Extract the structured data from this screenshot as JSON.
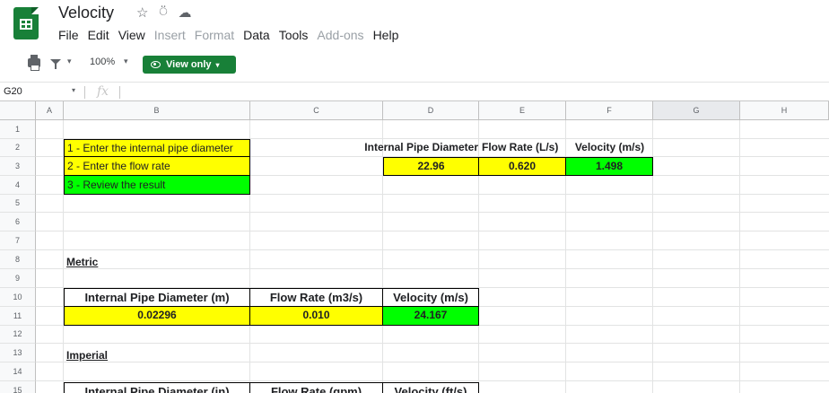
{
  "doc": {
    "title": "Velocity"
  },
  "title_icons": {
    "star": "☆",
    "share": "⍥",
    "cloud": "☁"
  },
  "menu": [
    {
      "label": "File",
      "enabled": true
    },
    {
      "label": "Edit",
      "enabled": true
    },
    {
      "label": "View",
      "enabled": true
    },
    {
      "label": "Insert",
      "enabled": false
    },
    {
      "label": "Format",
      "enabled": false
    },
    {
      "label": "Data",
      "enabled": true
    },
    {
      "label": "Tools",
      "enabled": true
    },
    {
      "label": "Add-ons",
      "enabled": false
    },
    {
      "label": "Help",
      "enabled": true
    }
  ],
  "toolbar": {
    "zoom": "100%",
    "view_only": "View only",
    "caret": "▾"
  },
  "formula_bar": {
    "cell_ref": "G20",
    "fx": "fx"
  },
  "columns": [
    "A",
    "B",
    "C",
    "D",
    "E",
    "F",
    "G",
    "H"
  ],
  "rows": [
    "1",
    "2",
    "3",
    "4",
    "5",
    "6",
    "7",
    "8",
    "9",
    "10",
    "11",
    "12",
    "13",
    "14",
    "15"
  ],
  "steps": [
    "1 - Enter the internal pipe diameter",
    "2 - Enter the flow rate",
    "3 - Review the result"
  ],
  "summary": {
    "headers": [
      "Internal Pipe Diameter",
      "Flow Rate (L/s)",
      "Velocity (m/s)"
    ],
    "values": [
      "22.96",
      "0.620",
      "1.498"
    ]
  },
  "metric": {
    "label": "Metric",
    "headers": [
      "Internal Pipe Diameter (m)",
      "Flow Rate (m3/s)",
      "Velocity (m/s)"
    ],
    "values": [
      "0.02296",
      "0.010",
      "24.167"
    ]
  },
  "imperial": {
    "label": "Imperial",
    "headers": [
      "Internal Pipe Diameter (in)",
      "Flow Rate (gpm)",
      "Velocity (ft/s)"
    ]
  },
  "colors": {
    "yellow": "#ffff00",
    "green": "#00ff00",
    "brand": "#188038"
  }
}
